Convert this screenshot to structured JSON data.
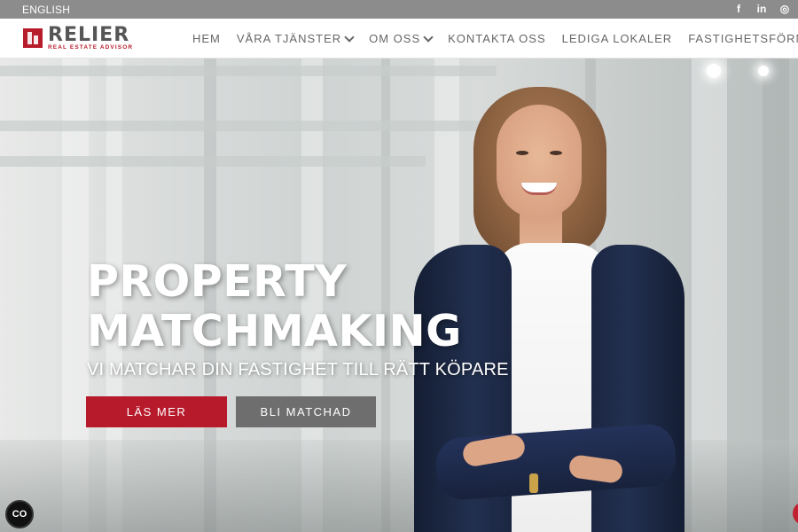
{
  "topbar": {
    "language_link": "ENGLISH",
    "social": [
      {
        "icon": "facebook-icon",
        "glyph": "f"
      },
      {
        "icon": "linkedin-icon",
        "glyph": "in"
      },
      {
        "icon": "instagram-icon",
        "glyph": "◎"
      }
    ]
  },
  "brand": {
    "name": "RELIER",
    "tagline": "REAL ESTATE ADVISOR",
    "accent_color": "#b61a2b"
  },
  "nav": {
    "items": [
      {
        "label": "HEM",
        "has_dropdown": false
      },
      {
        "label": "VÅRA TJÄNSTER",
        "has_dropdown": true
      },
      {
        "label": "OM OSS",
        "has_dropdown": true
      },
      {
        "label": "KONTAKTA OSS",
        "has_dropdown": false
      },
      {
        "label": "LEDIGA LOKALER",
        "has_dropdown": false
      },
      {
        "label": "FASTIGHETSFÖRMEDLI",
        "has_dropdown": false
      }
    ]
  },
  "hero": {
    "headline_line1": "PROPERTY",
    "headline_line2": "MATCHMAKING",
    "subheadline": "VI MATCHAR DIN FASTIGHET TILL RÄTT KÖPARE",
    "primary_button": "LÄS MER",
    "secondary_button": "BLI MATCHAD",
    "secondary_color": "#6e6e6e"
  },
  "floating": {
    "badge_icon": "cookie-consent-icon",
    "badge_glyph": "CO"
  }
}
